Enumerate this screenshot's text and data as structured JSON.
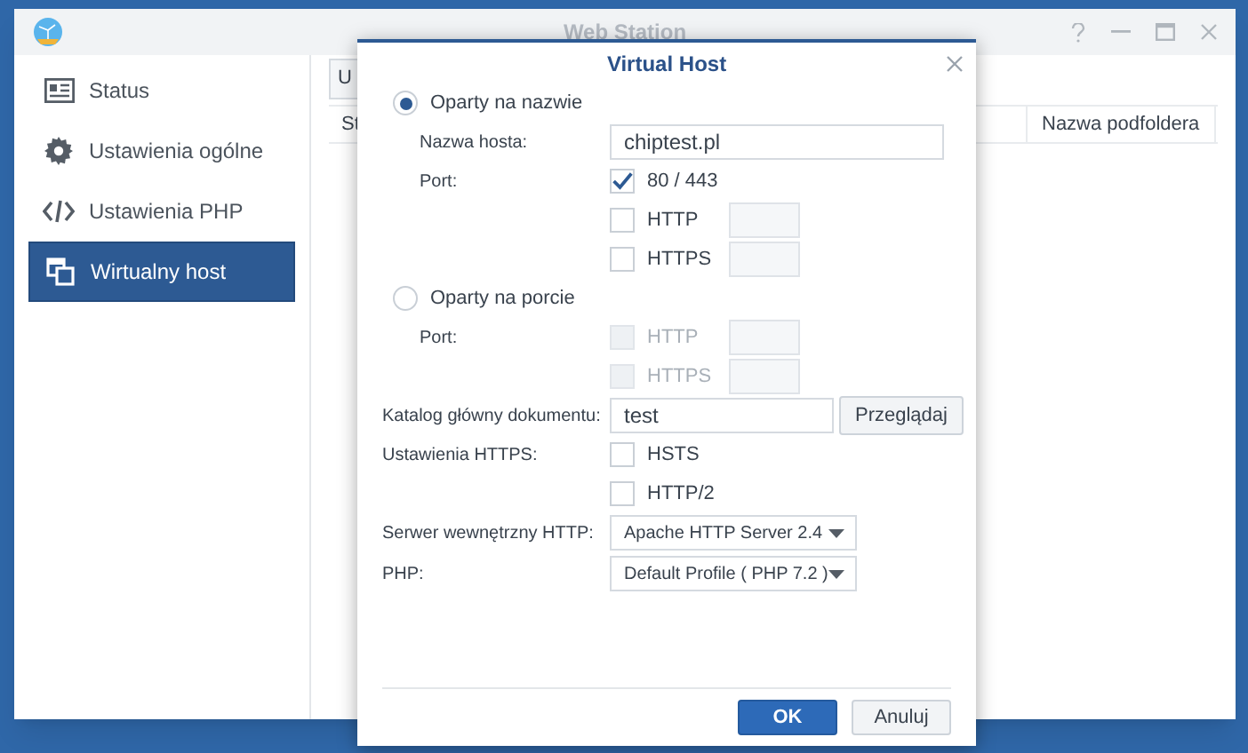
{
  "window": {
    "title": "Web Station"
  },
  "sidebar": {
    "items": [
      {
        "label": "Status",
        "selected": false
      },
      {
        "label": "Ustawienia ogólne",
        "selected": false
      },
      {
        "label": "Ustawienia PHP",
        "selected": false
      },
      {
        "label": "Wirtualny host",
        "selected": true
      }
    ]
  },
  "toolbar": {
    "button": "U"
  },
  "table": {
    "columns": [
      "St",
      "Nazwa podfoldera"
    ]
  },
  "dialog": {
    "title": "Virtual Host",
    "name_based": {
      "label": "Oparty na nazwie",
      "selected": true,
      "hostname": {
        "label": "Nazwa hosta:",
        "value": "chiptest.pl"
      },
      "port": {
        "label": "Port:",
        "options": [
          {
            "label": "80 / 443",
            "checked": true,
            "disabled": false,
            "kind": "plain"
          },
          {
            "label": "HTTP",
            "checked": false,
            "disabled": false,
            "kind": "with_field"
          },
          {
            "label": "HTTPS",
            "checked": false,
            "disabled": false,
            "kind": "with_field"
          }
        ]
      }
    },
    "port_based": {
      "label": "Oparty na porcie",
      "selected": false,
      "port": {
        "label": "Port:",
        "options": [
          {
            "label": "HTTP",
            "checked": false,
            "disabled": true,
            "kind": "with_field"
          },
          {
            "label": "HTTPS",
            "checked": false,
            "disabled": true,
            "kind": "with_field"
          }
        ]
      }
    },
    "document_root": {
      "label": "Katalog główny dokumentu:",
      "value": "test",
      "button": "Przeglądaj"
    },
    "https_settings": {
      "label": "Ustawienia HTTPS:",
      "options": [
        {
          "label": "HSTS",
          "checked": false
        },
        {
          "label": "HTTP/2",
          "checked": false
        }
      ]
    },
    "http_server": {
      "label": "Serwer wewnętrzny HTTP:",
      "value": "Apache HTTP Server 2.4"
    },
    "php": {
      "label": "PHP:",
      "value": "Default Profile ( PHP 7.2 )"
    },
    "buttons": [
      {
        "label": "OK",
        "kind": "primary"
      },
      {
        "label": "Anuluj",
        "kind": "secondary"
      }
    ]
  }
}
